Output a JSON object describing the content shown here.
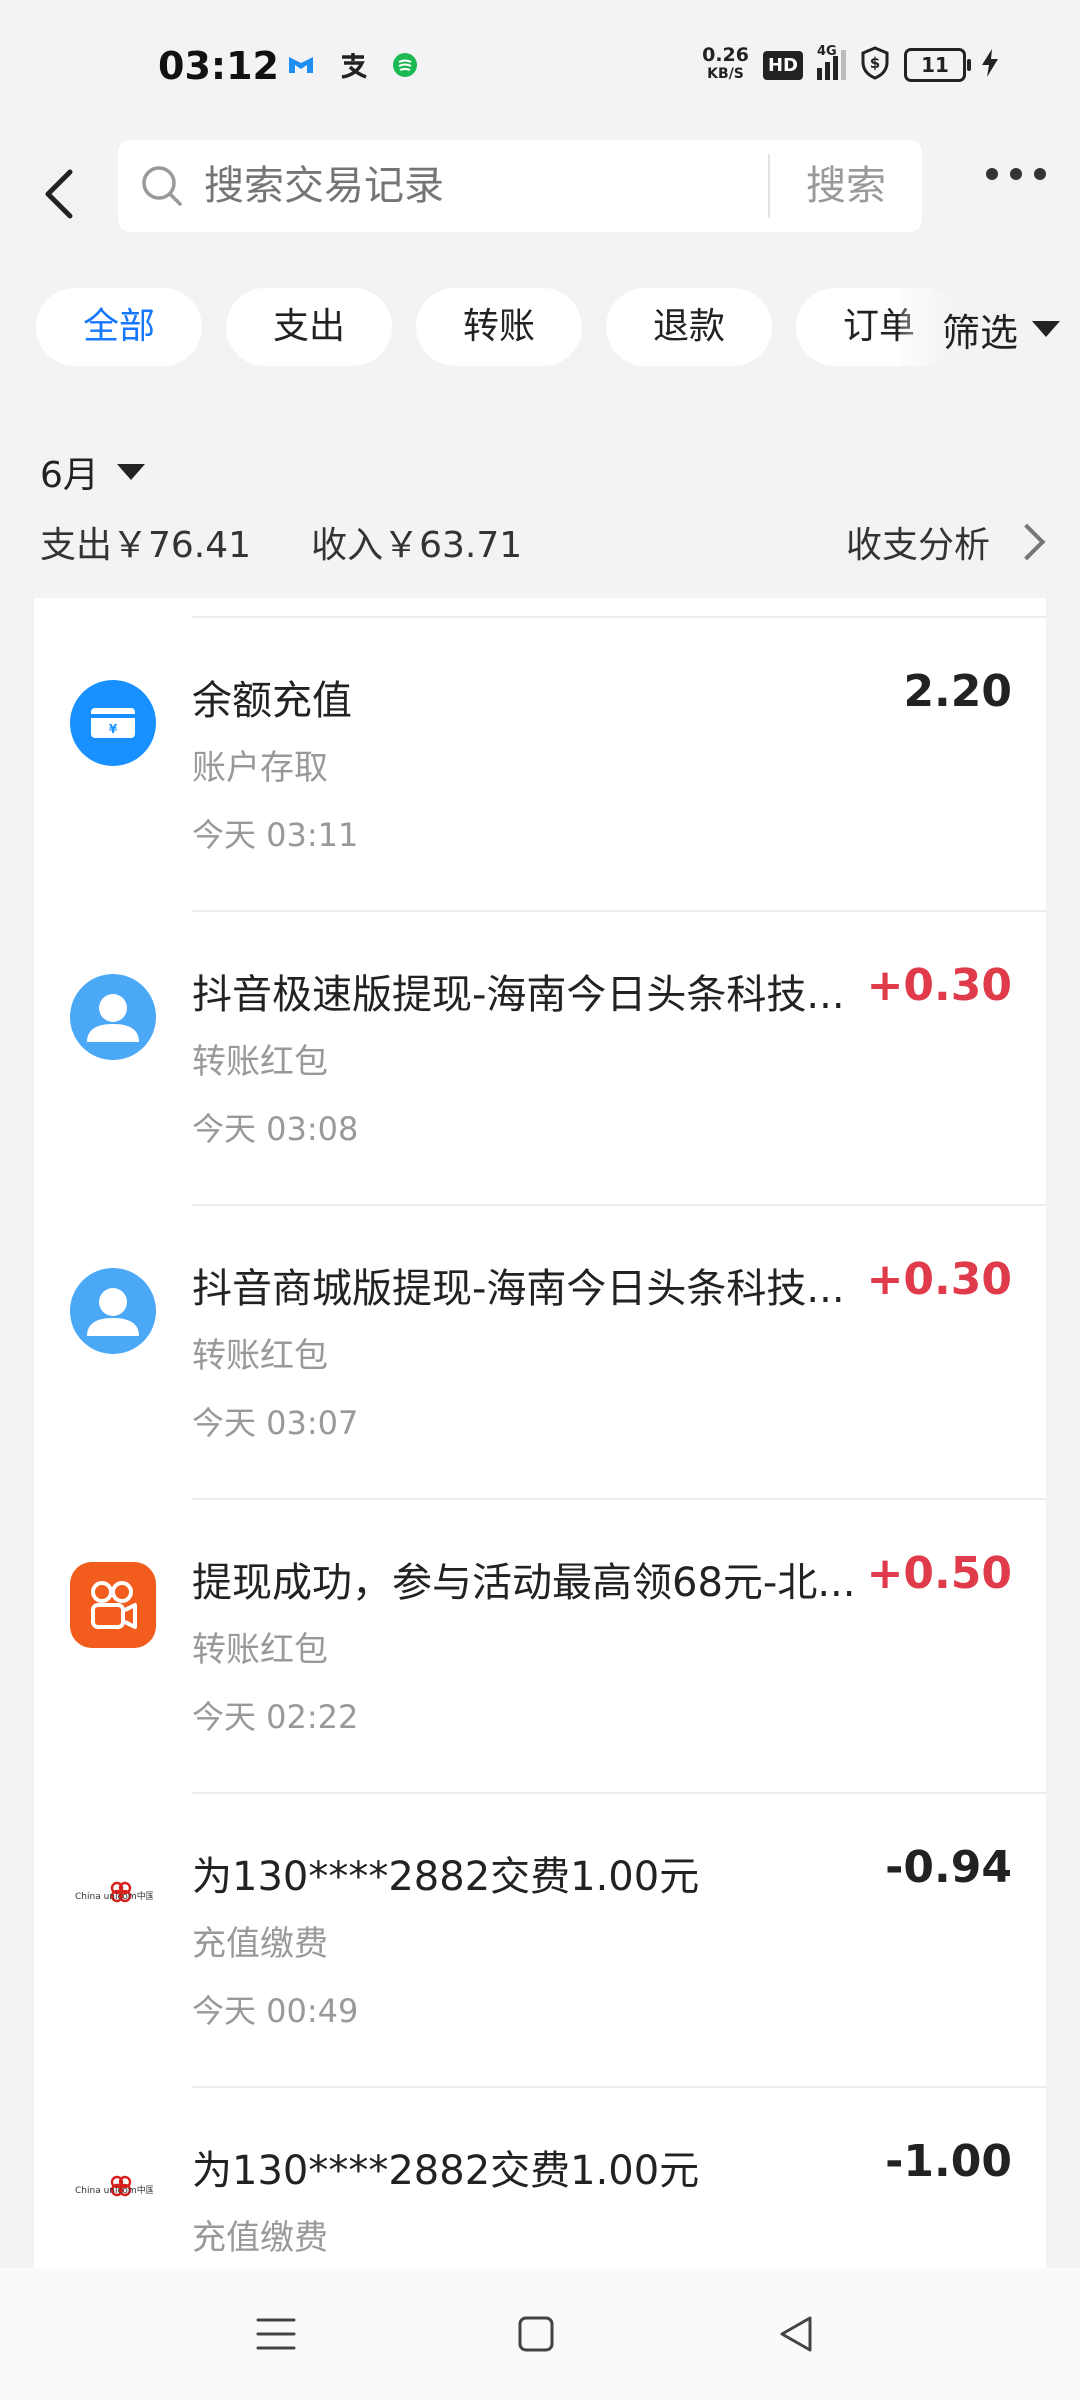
{
  "status_bar": {
    "time": "03:12",
    "net_speed_value": "0.26",
    "net_speed_unit": "KB/S",
    "hd": "HD",
    "network": "4G",
    "battery": "11"
  },
  "header": {
    "search_placeholder": "搜索交易记录",
    "search_button": "搜索"
  },
  "chips": [
    {
      "label": "全部",
      "active": true
    },
    {
      "label": "支出"
    },
    {
      "label": "转账"
    },
    {
      "label": "退款"
    },
    {
      "label": "订单"
    }
  ],
  "filter_label": "筛选",
  "month": {
    "label": "6月",
    "expense": "支出￥76.41",
    "income": "收入￥63.71",
    "analysis": "收支分析"
  },
  "transactions": [
    {
      "title": "余额充值",
      "category": "账户存取",
      "time": "今天 03:11",
      "amount": "2.20",
      "type": "neutral",
      "icon": "balance-card-icon"
    },
    {
      "title": "抖音极速版提现-海南今日头条科技...",
      "category": "转账红包",
      "time": "今天 03:08",
      "amount": "+0.30",
      "type": "income",
      "icon": "person-avatar-icon"
    },
    {
      "title": "抖音商城版提现-海南今日头条科技...",
      "category": "转账红包",
      "time": "今天 03:07",
      "amount": "+0.30",
      "type": "income",
      "icon": "person-avatar-icon"
    },
    {
      "title": "提现成功，参与活动最高领68元-北...",
      "category": "转账红包",
      "time": "今天 02:22",
      "amount": "+0.50",
      "type": "income",
      "icon": "kuaishou-logo-icon"
    },
    {
      "title": "为130****2882交费1.00元",
      "category": "充值缴费",
      "time": "今天 00:49",
      "amount": "-0.94",
      "type": "neutral",
      "icon": "china-unicom-logo-icon"
    },
    {
      "title": "为130****2882交费1.00元",
      "category": "充值缴费",
      "time": "",
      "amount": "-1.00",
      "type": "neutral",
      "icon": "china-unicom-logo-icon"
    }
  ],
  "unicom_logo_text": "China unicom中国联通"
}
